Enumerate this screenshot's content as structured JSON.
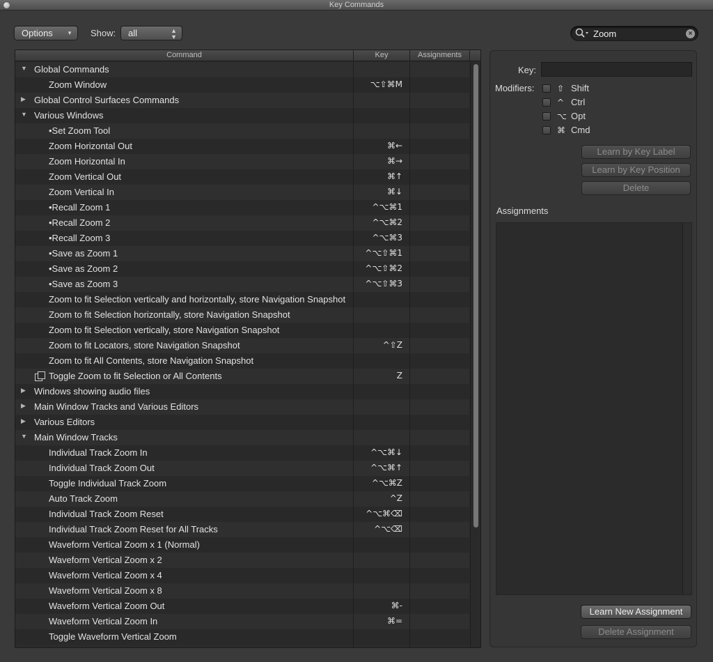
{
  "window": {
    "title": "Key Commands"
  },
  "toolbar": {
    "options_label": "Options",
    "show_label": "Show:",
    "show_value": "all",
    "search_value": "Zoom"
  },
  "table": {
    "columns": [
      "Command",
      "Key",
      "Assignments"
    ],
    "rows": [
      {
        "label": "Global Commands",
        "key": "",
        "level": 0,
        "expand": "open"
      },
      {
        "label": "Zoom Window",
        "key": "⌥⇧⌘M",
        "level": 1,
        "expand": "none"
      },
      {
        "label": "Global Control Surfaces Commands",
        "key": "",
        "level": 0,
        "expand": "closed"
      },
      {
        "label": "Various Windows",
        "key": "",
        "level": 0,
        "expand": "open"
      },
      {
        "label": "•Set Zoom Tool",
        "key": "",
        "level": 1,
        "expand": "none"
      },
      {
        "label": "Zoom Horizontal Out",
        "key": "⌘←",
        "level": 1,
        "expand": "none"
      },
      {
        "label": "Zoom Horizontal In",
        "key": "⌘→",
        "level": 1,
        "expand": "none"
      },
      {
        "label": "Zoom Vertical Out",
        "key": "⌘↑",
        "level": 1,
        "expand": "none"
      },
      {
        "label": "Zoom Vertical In",
        "key": "⌘↓",
        "level": 1,
        "expand": "none"
      },
      {
        "label": "•Recall Zoom 1",
        "key": "^⌥⌘1",
        "level": 1,
        "expand": "none"
      },
      {
        "label": "•Recall Zoom 2",
        "key": "^⌥⌘2",
        "level": 1,
        "expand": "none"
      },
      {
        "label": "•Recall Zoom 3",
        "key": "^⌥⌘3",
        "level": 1,
        "expand": "none"
      },
      {
        "label": "•Save as Zoom 1",
        "key": "^⌥⇧⌘1",
        "level": 1,
        "expand": "none"
      },
      {
        "label": "•Save as Zoom 2",
        "key": "^⌥⇧⌘2",
        "level": 1,
        "expand": "none"
      },
      {
        "label": "•Save as Zoom 3",
        "key": "^⌥⇧⌘3",
        "level": 1,
        "expand": "none"
      },
      {
        "label": "Zoom to fit Selection vertically and horizontally, store Navigation Snapshot",
        "key": "",
        "level": 1,
        "expand": "none"
      },
      {
        "label": "Zoom to fit Selection horizontally, store Navigation Snapshot",
        "key": "",
        "level": 1,
        "expand": "none"
      },
      {
        "label": "Zoom to fit Selection vertically, store Navigation Snapshot",
        "key": "",
        "level": 1,
        "expand": "none"
      },
      {
        "label": "Zoom to fit Locators, store Navigation Snapshot",
        "key": "^⇧Z",
        "level": 1,
        "expand": "none"
      },
      {
        "label": "Zoom to fit All Contents, store Navigation Snapshot",
        "key": "",
        "level": 1,
        "expand": "none"
      },
      {
        "label": "Toggle Zoom to fit Selection or All Contents",
        "key": "Z",
        "level": 1,
        "expand": "none",
        "icon": "copy-icon"
      },
      {
        "label": "Windows showing audio files",
        "key": "",
        "level": 0,
        "expand": "closed"
      },
      {
        "label": "Main Window Tracks and Various Editors",
        "key": "",
        "level": 0,
        "expand": "closed"
      },
      {
        "label": "Various Editors",
        "key": "",
        "level": 0,
        "expand": "closed"
      },
      {
        "label": "Main Window Tracks",
        "key": "",
        "level": 0,
        "expand": "open"
      },
      {
        "label": "Individual Track Zoom In",
        "key": "^⌥⌘↓",
        "level": 1,
        "expand": "none"
      },
      {
        "label": "Individual Track Zoom Out",
        "key": "^⌥⌘↑",
        "level": 1,
        "expand": "none"
      },
      {
        "label": "Toggle Individual Track Zoom",
        "key": "^⌥⌘Z",
        "level": 1,
        "expand": "none"
      },
      {
        "label": "Auto Track Zoom",
        "key": "^Z",
        "level": 1,
        "expand": "none"
      },
      {
        "label": "Individual Track Zoom Reset",
        "key": "^⌥⌘⌫",
        "level": 1,
        "expand": "none"
      },
      {
        "label": "Individual Track Zoom Reset for All Tracks",
        "key": "^⌥⌫",
        "level": 1,
        "expand": "none"
      },
      {
        "label": "Waveform Vertical Zoom x 1 (Normal)",
        "key": "",
        "level": 1,
        "expand": "none"
      },
      {
        "label": "Waveform Vertical Zoom x 2",
        "key": "",
        "level": 1,
        "expand": "none"
      },
      {
        "label": "Waveform Vertical Zoom x 4",
        "key": "",
        "level": 1,
        "expand": "none"
      },
      {
        "label": "Waveform Vertical Zoom x 8",
        "key": "",
        "level": 1,
        "expand": "none"
      },
      {
        "label": "Waveform Vertical Zoom Out",
        "key": "⌘-",
        "level": 1,
        "expand": "none"
      },
      {
        "label": "Waveform Vertical Zoom In",
        "key": "⌘=",
        "level": 1,
        "expand": "none"
      },
      {
        "label": "Toggle Waveform Vertical Zoom",
        "key": "",
        "level": 1,
        "expand": "none"
      }
    ]
  },
  "panel": {
    "key_label": "Key:",
    "key_value": "",
    "modifiers_label": "Modifiers:",
    "modifiers": [
      {
        "symbol": "⇧",
        "name": "Shift",
        "checked": false
      },
      {
        "symbol": "^",
        "name": "Ctrl",
        "checked": false
      },
      {
        "symbol": "⌥",
        "name": "Opt",
        "checked": false
      },
      {
        "symbol": "⌘",
        "name": "Cmd",
        "checked": false
      }
    ],
    "learn_label_btn": "Learn by Key Label",
    "learn_position_btn": "Learn by Key Position",
    "delete_btn": "Delete",
    "assignments_label": "Assignments",
    "learn_new_btn": "Learn New Assignment",
    "delete_assignment_btn": "Delete Assignment"
  },
  "icons": {
    "search": "search-icon",
    "clear": "clear-icon",
    "expand_open": "disclosure-open-icon",
    "expand_closed": "disclosure-closed-icon",
    "copy": "copy-icon"
  }
}
